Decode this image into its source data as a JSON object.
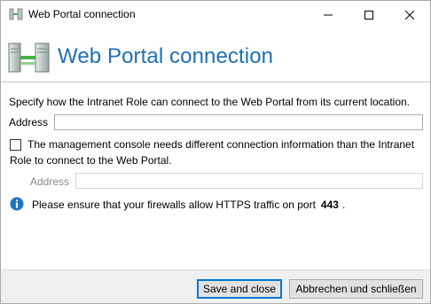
{
  "window": {
    "title": "Web Portal connection",
    "controls": {
      "minimize": "minimize",
      "maximize": "maximize",
      "close": "close"
    }
  },
  "header": {
    "title": "Web Portal connection"
  },
  "form": {
    "intro": "Specify how the Intranet Role can connect to the Web Portal from its current location.",
    "address_label": "Address",
    "address_value": "",
    "different_connection": {
      "checked": false,
      "label_line1": "The management console needs different connection information than the Intranet",
      "label_line2": "Role to connect to the Web Portal."
    },
    "console_address_label": "Address",
    "console_address_value": ""
  },
  "info": {
    "text": "Please ensure that your firewalls allow HTTPS traffic on port",
    "port": "443",
    "end": "."
  },
  "footer": {
    "save_label": "Save and close",
    "cancel_label": "Abbrechen und schließen"
  },
  "colors": {
    "header_title": "#1e6fb5",
    "info_icon": "#1c72c4",
    "default_button_border": "#0078d7"
  }
}
